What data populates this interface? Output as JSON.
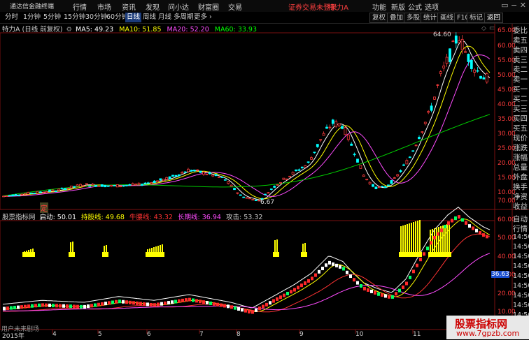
{
  "app": {
    "title": "通达信金融终端",
    "menu": [
      "行情",
      "市场",
      "资讯",
      "发现",
      "问小达",
      "财富圈",
      "交易"
    ],
    "login_status": "证券交易未登录",
    "stock_name": "特 力A",
    "toolbar": [
      "功能",
      "新版",
      "公式",
      "选项"
    ],
    "window_controls": "▭ − ✕"
  },
  "period_tabs": [
    "分时",
    "1分钟",
    "5分钟",
    "15分钟",
    "30分钟",
    "60分钟",
    "日线",
    "周线",
    "月线",
    "多周期",
    "更多 ›"
  ],
  "active_period": "日线",
  "right_tools": [
    "复权",
    "叠加",
    "多股",
    "统计",
    "画线",
    "F10",
    "标记",
    "返回"
  ],
  "main_chart": {
    "stock_label": "特力A (日线 前复权)",
    "ma": [
      {
        "name": "MA5",
        "value": "49.23",
        "color": "#ffffff"
      },
      {
        "name": "MA10",
        "value": "51.85",
        "color": "#ffff00"
      },
      {
        "name": "MA20",
        "value": "52.20",
        "color": "#ff4cff"
      },
      {
        "name": "MA60",
        "value": "33.93",
        "color": "#00ff00"
      }
    ],
    "price_axis": [
      "65.00",
      "60.00",
      "55.00",
      "50.00",
      "45.00",
      "40.00",
      "35.00",
      "30.00",
      "25.00",
      "20.00",
      "15.00",
      "10.00"
    ],
    "high_label": "64.60",
    "low_label": "6.67",
    "marker": "定"
  },
  "indicator": {
    "name": "股票指标网",
    "items": [
      {
        "name": "启动",
        "value": "50.01",
        "color": "#ffffff"
      },
      {
        "name": "持股线",
        "value": "49.68",
        "color": "#ffff00"
      },
      {
        "name": "牛腰线",
        "value": "43.32",
        "color": "#ff3333"
      },
      {
        "name": "长期线",
        "value": "36.94",
        "color": "#ff4cff"
      },
      {
        "name": "攻击",
        "value": "53.32",
        "color": "#cfcfcf"
      }
    ],
    "axis": [
      "70.00",
      "60.00",
      "50.00",
      "40.00",
      "30.00",
      "20.00",
      "10.00"
    ],
    "current_value": "36.63",
    "bottom_note": "用户未来剧场"
  },
  "right_panel": [
    "委比",
    "卖五",
    "卖四",
    "卖三",
    "卖二",
    "卖一",
    "买一",
    "买二",
    "买三",
    "买四",
    "买五",
    "现价",
    "涨跌",
    "涨幅",
    "总量",
    "外盘",
    "换手",
    "净资",
    "收益",
    "自动",
    "行情",
    "14:50",
    "14:50",
    "14:50",
    "14:50",
    "14:50",
    "14:50",
    "14:50",
    "14:50",
    "14:50"
  ],
  "x_axis": [
    "2015年",
    "4",
    "5",
    "6",
    "7",
    "8",
    "9",
    "10",
    "11"
  ],
  "watermark": {
    "title": "股票指标网",
    "url": "www.7gpzb.com"
  },
  "colors": {
    "up": "#ff3c3c",
    "down": "#00ffff",
    "volume_bar": "#ffff00"
  }
}
